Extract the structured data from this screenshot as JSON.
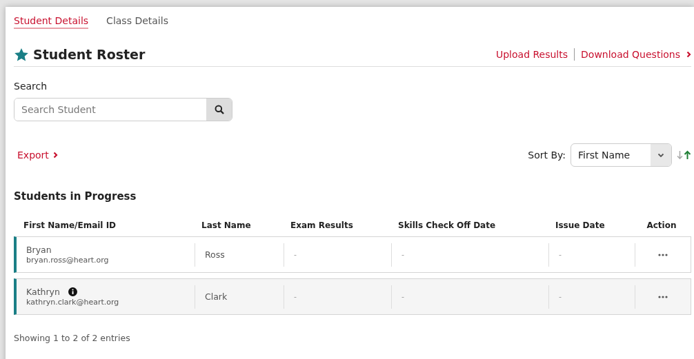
{
  "tabs": [
    {
      "label": "Student Details",
      "selected": true
    },
    {
      "label": "Class Details",
      "selected": false
    }
  ],
  "header": {
    "title": "Student Roster",
    "links": [
      "Upload Results",
      "Download Questions"
    ]
  },
  "search": {
    "label": "Search",
    "placeholder": "Search Student"
  },
  "export": {
    "label": "Export"
  },
  "sort": {
    "label": "Sort By:",
    "value": "First Name",
    "ascending": true
  },
  "section_title": "Students in Progress",
  "table": {
    "columns": [
      "First Name/Email ID",
      "Last Name",
      "Exam Results",
      "Skills Check Off Date",
      "Issue Date",
      "Action"
    ],
    "rows": [
      {
        "first_name": "Bryan",
        "email": "bryan.ross@heart.org",
        "info": false,
        "highlighted": false,
        "last_name": "Ross",
        "exam_results": "-",
        "skills_check_off_date": "-",
        "issue_date": "-"
      },
      {
        "first_name": "Kathryn",
        "email": "kathryn.clark@heart.org",
        "info": true,
        "highlighted": true,
        "last_name": "Clark",
        "exam_results": "-",
        "skills_check_off_date": "-",
        "issue_date": "-"
      }
    ]
  },
  "footer": "Showing 1 to 2 of 2 entries"
}
